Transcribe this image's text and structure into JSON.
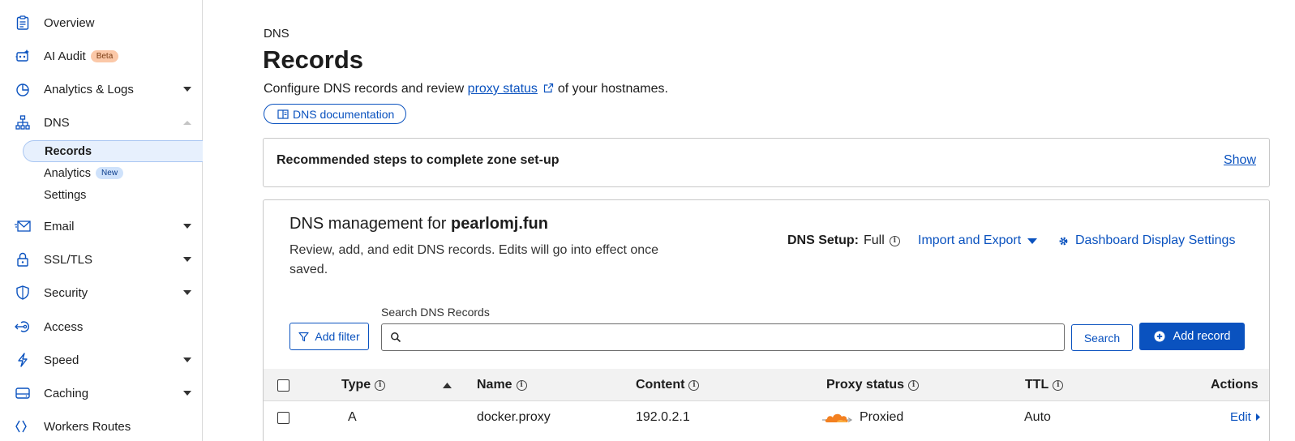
{
  "sidebar": {
    "items": [
      {
        "label": "Overview",
        "icon": "clipboard-icon"
      },
      {
        "label": "AI Audit",
        "badge": "Beta",
        "icon": "robot-icon"
      },
      {
        "label": "Analytics & Logs",
        "icon": "pie-chart-icon"
      },
      {
        "label": "DNS",
        "icon": "sitemap-icon"
      },
      {
        "label": "Email",
        "icon": "envelope-icon"
      },
      {
        "label": "SSL/TLS",
        "icon": "lock-icon"
      },
      {
        "label": "Security",
        "icon": "shield-icon"
      },
      {
        "label": "Access",
        "icon": "access-icon"
      },
      {
        "label": "Speed",
        "icon": "lightning-icon"
      },
      {
        "label": "Caching",
        "icon": "drive-icon"
      },
      {
        "label": "Workers Routes",
        "icon": "workers-icon"
      }
    ],
    "dns_sub": [
      {
        "label": "Records"
      },
      {
        "label": "Analytics",
        "badge": "New"
      },
      {
        "label": "Settings"
      }
    ]
  },
  "page": {
    "breadcrumb": "DNS",
    "title": "Records",
    "desc_before": "Configure DNS records and review ",
    "desc_link": "proxy status",
    "desc_after": " of your hostnames.",
    "doc_button": "DNS documentation"
  },
  "steps": {
    "title": "Recommended steps to complete zone set-up",
    "show": "Show"
  },
  "management": {
    "heading_prefix": "DNS management for ",
    "domain": "pearlomj.fun",
    "description": "Review, add, and edit DNS records. Edits will go into effect once saved.",
    "setup_label": "DNS Setup:",
    "setup_value": "Full",
    "import_export": "Import and Export",
    "dashboard_settings": "Dashboard Display Settings",
    "add_filter": "Add filter",
    "search_label": "Search DNS Records",
    "search_value": "",
    "search_button": "Search",
    "add_record": "Add record"
  },
  "table": {
    "headers": {
      "type": "Type",
      "name": "Name",
      "content": "Content",
      "proxy": "Proxy status",
      "ttl": "TTL",
      "actions": "Actions"
    },
    "rows": [
      {
        "type": "A",
        "name": "docker.proxy",
        "content": "192.0.2.1",
        "proxy": "Proxied",
        "ttl": "Auto",
        "action": "Edit"
      }
    ]
  },
  "colors": {
    "accent": "#0a52bf",
    "proxied": "#f38020"
  }
}
